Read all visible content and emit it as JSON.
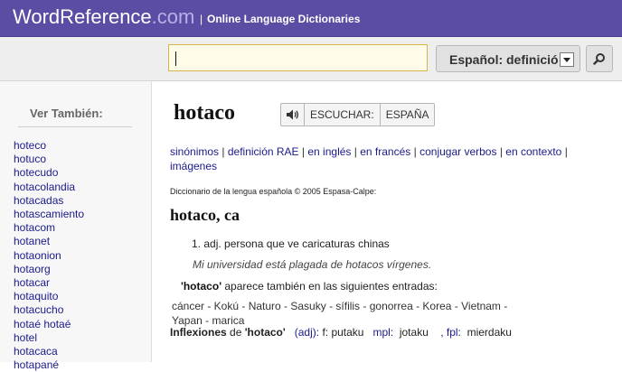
{
  "header": {
    "logo_main": "WordReference",
    "logo_suffix": ".com",
    "separator": "|",
    "tagline": "Online Language Dictionaries"
  },
  "search": {
    "value": "",
    "dictionary_label": "Español: definición",
    "search_icon": "magnifier-icon"
  },
  "sidebar": {
    "heading": "Ver También:",
    "items": [
      "hoteco",
      "hotuco",
      "hotecudo",
      "hotacolandia",
      "hotacadas",
      "hotascamiento",
      "hotacom",
      "hotanet",
      "hotaonion",
      "hotaorg",
      "hotacar",
      "hotaquito",
      "hotacucho",
      "hotaé hotaé",
      "hotel",
      "hotacaca",
      "hotapané"
    ]
  },
  "main": {
    "headword": "hotaco",
    "audio": {
      "speaker_icon": "speaker-icon",
      "listen": "ESCUCHAR:",
      "region": "ESPAÑA"
    },
    "links": [
      {
        "label": "sinónimos"
      },
      {
        "label": "definición RAE"
      },
      {
        "label": "en inglés"
      },
      {
        "label": "en francés"
      },
      {
        "label": "conjugar verbos"
      },
      {
        "label": "en contexto"
      },
      {
        "label": "imágenes"
      }
    ],
    "link_separator": "|",
    "copyright": "Diccionario de la lengua española © 2005 Espasa-Calpe:",
    "entry_title": "hotaco, ca",
    "definition": "1. adj. persona que ve caricaturas chinas",
    "example": "Mi universidad está plagada de hotacos vírgenes.",
    "also_term": "'hotaco'",
    "also_text": " aparece también en las siguientes entradas:",
    "also_words": "cáncer - Kokú - Naturo - Sasuky - sífilis - gonorrea - Korea - Vietnam - Yapan - marica",
    "inflections": {
      "label": "Inflexiones",
      "de": " de ",
      "term": "'hotaco'",
      "adj": "(adj):",
      "f_label": " f: ",
      "f_value": "putaku",
      "mpl_label": "mpl:",
      "mpl_value": "jotaku",
      "fpl_label": ", fpl:",
      "fpl_value": "mierdaku"
    }
  }
}
